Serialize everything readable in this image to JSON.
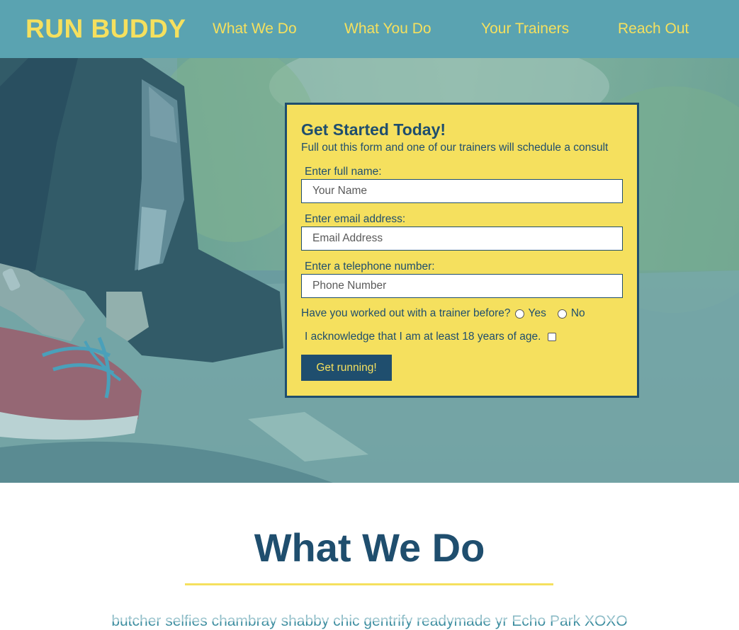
{
  "header": {
    "brand": "RUN BUDDY",
    "nav": [
      "What We Do",
      "What You Do",
      "Your Trainers",
      "Reach Out"
    ],
    "colors": {
      "background": "#5aa3b1",
      "accent": "#f5e05e"
    }
  },
  "form": {
    "title": "Get Started Today!",
    "subtitle": "Full out this form and one of our trainers will schedule a consult",
    "name_label": "Enter full name:",
    "name_placeholder": "Your Name",
    "email_label": "Enter email address:",
    "email_placeholder": "Email Address",
    "phone_label": "Enter a telephone number:",
    "phone_placeholder": "Phone Number",
    "trainer_question": "Have you worked out with a trainer before?",
    "yes_label": "Yes",
    "no_label": "No",
    "age_ack": "I acknowledge that I am at least 18 years of age.",
    "submit_label": "Get running!",
    "colors": {
      "panel": "#f5e05e",
      "text": "#1f4e6e"
    }
  },
  "section": {
    "title": "What We Do",
    "text": "butcher selfies chambray shabby chic gentrify readymade yr Echo Park XOXO"
  }
}
